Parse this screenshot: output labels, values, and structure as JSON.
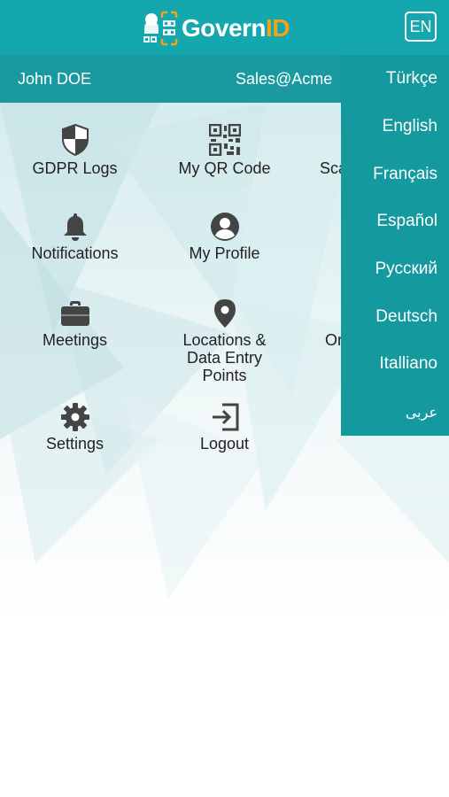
{
  "header": {
    "logo_text_main": "Govern",
    "logo_text_accent": "ID",
    "language_button": "EN"
  },
  "user": {
    "name": "John DOE",
    "email": "Sales@Acme"
  },
  "tiles": {
    "gdpr_logs": "GDPR Logs",
    "my_qr_code": "My QR Code",
    "scan_partial": "Sca",
    "notifications": "Notifications",
    "my_profile": "My Profile",
    "meetings": "Meetings",
    "locations_line1": "Locations &",
    "locations_line2": "Data Entry",
    "locations_line3": "Points",
    "third_col_partial": "Or",
    "settings": "Settings",
    "logout": "Logout"
  },
  "languages": [
    "Türkçe",
    "English",
    "Français",
    "Español",
    "Русский",
    "Deutsch",
    "Italliano",
    "عربى"
  ],
  "colors": {
    "header": "#14a7ad",
    "userbar": "#1a9aa0",
    "menu": "#14999f",
    "logo_accent": "#f3a21d",
    "icons": "#444444"
  }
}
